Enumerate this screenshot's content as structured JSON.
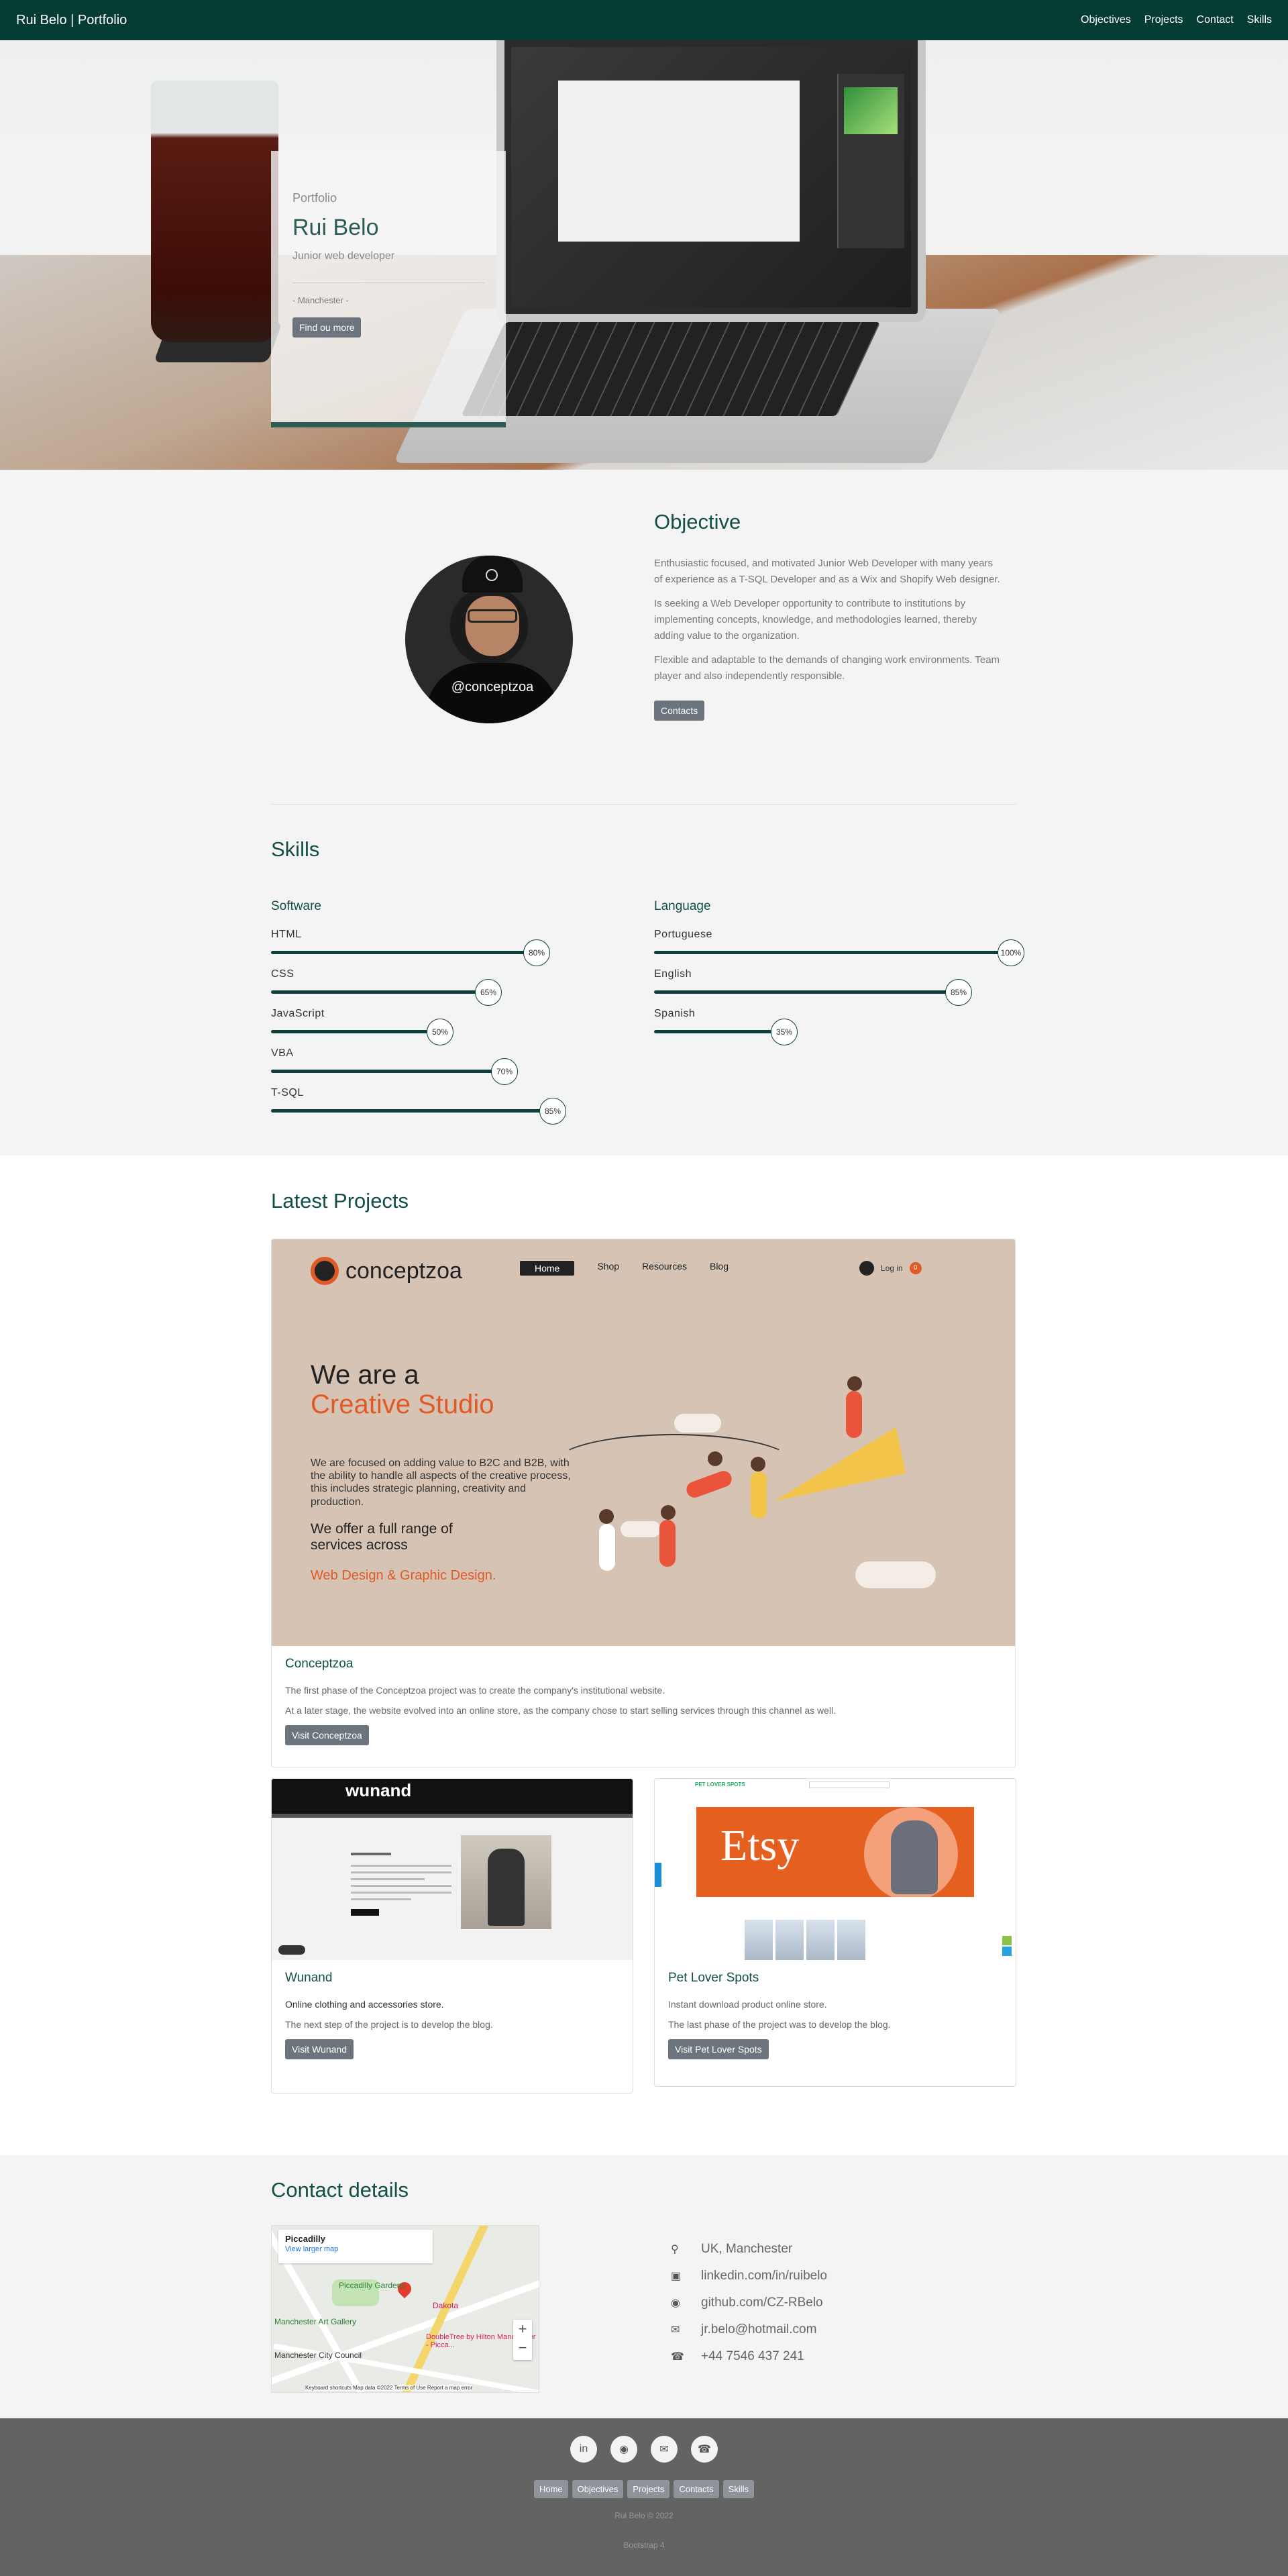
{
  "nav": {
    "brand": "Rui Belo | Portfolio",
    "links": [
      "Objectives",
      "Projects",
      "Contact",
      "Skills"
    ]
  },
  "hero": {
    "kicker": "Portfolio",
    "name": "Rui Belo",
    "role": "Junior web developer",
    "location": "- Manchester -",
    "button": "Find ou more"
  },
  "objective": {
    "title": "Objective",
    "avatar_handle": "@conceptzoa",
    "paragraphs": [
      "Enthusiastic focused, and motivated Junior Web Developer with many years of experience as a T-SQL Developer and as a Wix and Shopify Web designer.",
      "Is seeking a Web Developer opportunity to contribute to institutions by implementing concepts, knowledge, and methodologies learned, thereby adding value to the organization.",
      "Flexible and adaptable to the demands of changing work environments. Team player and also independently responsible."
    ],
    "button": "Contacts"
  },
  "skills": {
    "title": "Skills",
    "software": {
      "title": "Software",
      "items": [
        {
          "name": "HTML",
          "value": 80,
          "label": "80%"
        },
        {
          "name": "CSS",
          "value": 65,
          "label": "65%"
        },
        {
          "name": "JavaScript",
          "value": 50,
          "label": "50%"
        },
        {
          "name": "VBA",
          "value": 70,
          "label": "70%"
        },
        {
          "name": "T-SQL",
          "value": 85,
          "label": "85%"
        }
      ]
    },
    "language": {
      "title": "Language",
      "items": [
        {
          "name": "Portuguese",
          "value": 100,
          "label": "100%"
        },
        {
          "name": "English",
          "value": 85,
          "label": "85%"
        },
        {
          "name": "Spanish",
          "value": 35,
          "label": "35%"
        }
      ]
    }
  },
  "projects": {
    "title": "Latest Projects",
    "conceptzoa": {
      "title": "Conceptzoa",
      "p1": "The first phase of the Conceptzoa project was to create the company's institutional website.",
      "p2": "At a later stage, the website evolved into an online store, as the company chose to start selling services through this channel as well.",
      "button": "Visit Conceptzoa",
      "shot": {
        "logo": "conceptzoa",
        "menu": [
          "Home",
          "Shop",
          "Resources",
          "Blog"
        ],
        "login": "Log in",
        "cart_count": "0",
        "headline1": "We are a",
        "headline2": "Creative Studio",
        "para": "We are focused on adding value to B2C and B2B, with the ability to handle all aspects of the creative process, this includes strategic planning, creativity and production.",
        "offer": "We offer a full range of services across",
        "services": "Web Design & Graphic Design."
      }
    },
    "wunand": {
      "title": "Wunand",
      "p1": "Online clothing and accessories store.",
      "p2": "The next step of the project is to develop the blog.",
      "button": "Visit Wunand",
      "shot_logo": "wunand"
    },
    "petlover": {
      "title": "Pet Lover Spots",
      "p1": "Instant download product online store.",
      "p2": "The last phase of the project was to develop the blog.",
      "button": "Visit Pet Lover Spots",
      "shot_logo": "PET LOVER SPOTS",
      "shot_banner": "Etsy"
    }
  },
  "contact": {
    "title": "Contact details",
    "map": {
      "place": "Piccadilly",
      "link": "View larger map",
      "label_gardens": "Piccadilly Gardens",
      "label_gallery": "Manchester Art Gallery",
      "label_council": "Manchester City Council",
      "label_dakota": "Dakota",
      "label_hotel": "DoubleTree by Hilton Manchester - Picca...",
      "attribution": "Keyboard shortcuts  Map data ©2022  Terms of Use  Report a map error"
    },
    "items": [
      {
        "icon": "location-icon",
        "text": "UK, Manchester"
      },
      {
        "icon": "linkedin-icon",
        "text": "linkedin.com/in/ruibelo"
      },
      {
        "icon": "github-icon",
        "text": "github.com/CZ-RBelo"
      },
      {
        "icon": "email-icon",
        "text": "jr.belo@hotmail.com"
      },
      {
        "icon": "phone-icon",
        "text": "+44 7546 437 241"
      }
    ]
  },
  "footer": {
    "links": [
      "Home",
      "Objectives",
      "Projects",
      "Contacts",
      "Skills"
    ],
    "copyright": "Rui Belo © 2022",
    "made_with": "Bootstrap 4"
  },
  "colors": {
    "nav": "#053c34",
    "accent": "#114f47",
    "footer": "#636363"
  }
}
